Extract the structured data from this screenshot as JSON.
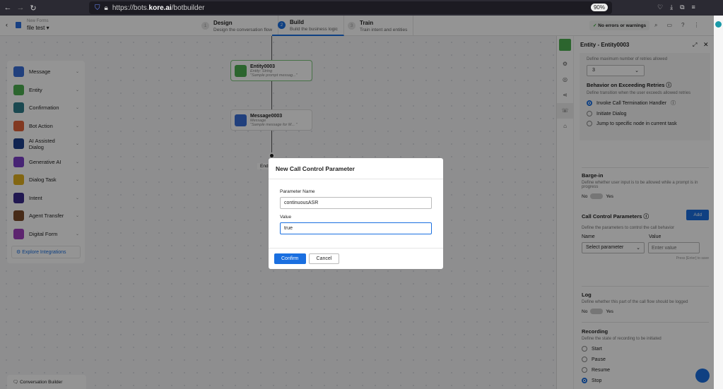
{
  "browser": {
    "url_prefix": "https://bots.",
    "url_domain": "kore.ai",
    "url_path": "/botbuilder",
    "zoom": "90%"
  },
  "header": {
    "breadcrumb": "New Forms",
    "bot_name": "file test",
    "steps": [
      {
        "num": "1",
        "title": "Design",
        "sub": "Design the conversation flow"
      },
      {
        "num": "2",
        "title": "Build",
        "sub": "Build the business logic"
      },
      {
        "num": "3",
        "title": "Train",
        "sub": "Train intent and entities"
      }
    ],
    "status": "No errors or warnings"
  },
  "palette": {
    "items": [
      {
        "label": "Message",
        "color": "#3a6fd8"
      },
      {
        "label": "Entity",
        "color": "#4caf50"
      },
      {
        "label": "Confirmation",
        "color": "#2d7d8a"
      },
      {
        "label": "Bot Action",
        "color": "#e0623a"
      },
      {
        "label": "AI Assisted Dialog",
        "color": "#1c3f8c"
      },
      {
        "label": "Generative AI",
        "color": "#7b3fc8"
      },
      {
        "label": "Dialog Task",
        "color": "#e0b020"
      },
      {
        "label": "Intent",
        "color": "#3a2a8c"
      },
      {
        "label": "Agent Transfer",
        "color": "#7a4a2a"
      },
      {
        "label": "Digital Form",
        "color": "#a03fc0"
      }
    ],
    "explore": "Explore Integrations"
  },
  "nodes": [
    {
      "title": "Entity0003",
      "type": "Entity: String",
      "msg": "\"Sample prompt messag...\"",
      "color": "#4caf50"
    },
    {
      "title": "Message0003",
      "type": "Message",
      "msg": "\"Sample message for M... \"",
      "color": "#3a6fd8"
    }
  ],
  "end_label": "End",
  "footer": {
    "conv_builder": "Conversation Builder"
  },
  "panel": {
    "title": "Entity - Entity0003",
    "retries_desc": "Define maximum number of retries allowed",
    "retries_value": "3",
    "exceed_title": "Behavior on Exceeding Retries",
    "exceed_desc": "Define transition when the user exceeds allowed retries",
    "exceed_options": [
      "Invoke Call Termination Handler",
      "Initiate Dialog",
      "Jump to specific node in current task"
    ],
    "barge_title": "Barge-in",
    "barge_desc": "Define whether user input is to be allowed while a prompt is in progress",
    "no": "No",
    "yes": "Yes",
    "ccp_title": "Call Control Parameters",
    "ccp_add": "Add",
    "ccp_desc": "Define the parameters to control the call behavior",
    "ccp_name": "Name",
    "ccp_value": "Value",
    "ccp_select": "Select parameter",
    "ccp_placeholder": "Enter value",
    "ccp_hint": "Press [Enter] to save",
    "log_title": "Log",
    "log_desc": "Define whether this part of the call flow should be logged",
    "rec_title": "Recording",
    "rec_desc": "Define the state of recording to be initiated",
    "rec_options": [
      "Start",
      "Pause",
      "Resume",
      "Stop"
    ]
  },
  "modal": {
    "title": "New Call Control Parameter",
    "name_label": "Parameter Name",
    "name_value": "continuousASR",
    "value_label": "Value",
    "value_value": "true",
    "confirm": "Confirm",
    "cancel": "Cancel"
  }
}
